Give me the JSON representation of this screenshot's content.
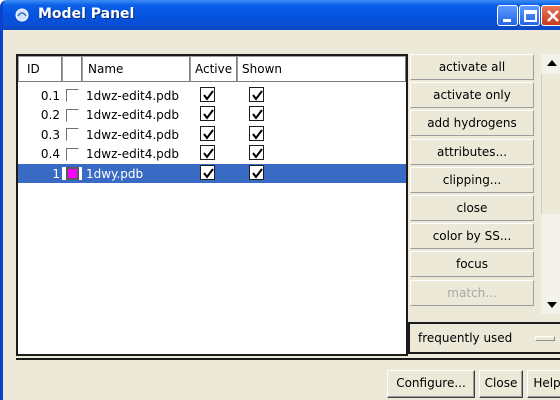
{
  "window": {
    "title": "Model Panel",
    "icon": "app-icon",
    "controls": [
      "minimize-icon",
      "maximize-icon",
      "close-icon"
    ]
  },
  "table": {
    "headers": {
      "id": "ID",
      "name": "Name",
      "active": "Active",
      "shown": "Shown"
    },
    "rows": [
      {
        "id": "0.1",
        "name": "1dwz-edit4.pdb",
        "active": true,
        "shown": true,
        "color": "#ffffff",
        "selected": false
      },
      {
        "id": "0.2",
        "name": "1dwz-edit4.pdb",
        "active": true,
        "shown": true,
        "color": "#ffffff",
        "selected": false
      },
      {
        "id": "0.3",
        "name": "1dwz-edit4.pdb",
        "active": true,
        "shown": true,
        "color": "#ffffff",
        "selected": false
      },
      {
        "id": "0.4",
        "name": "1dwz-edit4.pdb",
        "active": true,
        "shown": true,
        "color": "#ffffff",
        "selected": false
      },
      {
        "id": "1",
        "name": "1dwy.pdb",
        "active": true,
        "shown": true,
        "color": "#ff00ff",
        "selected": true
      }
    ]
  },
  "actions": [
    {
      "label": "activate all",
      "enabled": true
    },
    {
      "label": "activate only",
      "enabled": true
    },
    {
      "label": "add hydrogens",
      "enabled": true
    },
    {
      "label": "attributes...",
      "enabled": true
    },
    {
      "label": "clipping...",
      "enabled": true
    },
    {
      "label": "close",
      "enabled": true
    },
    {
      "label": "color by SS...",
      "enabled": true
    },
    {
      "label": "focus",
      "enabled": true
    },
    {
      "label": "match...",
      "enabled": false
    }
  ],
  "menu": {
    "label": "frequently used"
  },
  "footer": {
    "configure": "Configure...",
    "close": "Close",
    "help": "Help"
  },
  "colors": {
    "titlebar": "#0553e0",
    "selection": "#3a6bc4",
    "background": "#ece9d8"
  }
}
